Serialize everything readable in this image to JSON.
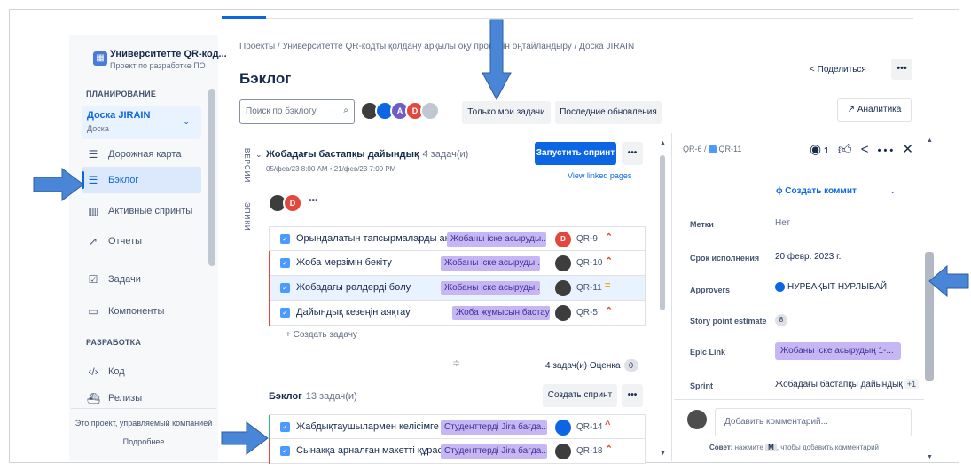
{
  "sidebar": {
    "project_name": "Университетте QR-код...",
    "project_type": "Проект по разработке ПО",
    "planning_header": "ПЛАНИРОВАНИЕ",
    "board_name": "Доска JIRAIN",
    "board_type": "Доска",
    "items": [
      {
        "label": "Дорожная карта",
        "icon": "roadmap-icon"
      },
      {
        "label": "Бэклог",
        "icon": "backlog-icon"
      },
      {
        "label": "Активные спринты",
        "icon": "sprint-board-icon"
      },
      {
        "label": "Отчеты",
        "icon": "reports-icon"
      },
      {
        "label": "Задачи",
        "icon": "issues-icon"
      },
      {
        "label": "Компоненты",
        "icon": "components-icon"
      }
    ],
    "dev_header": "РАЗРАБОТКА",
    "dev_items": [
      {
        "label": "Код",
        "icon": "code-icon"
      },
      {
        "label": "Релизы",
        "icon": "releases-icon"
      }
    ],
    "footer_text": "Это проект, управляемый компанией",
    "footer_link": "Подробнее"
  },
  "header": {
    "breadcrumb": "Проекты / Университетте QR-кодты қолдану арқылы оқу процесін оңтайландыру / Доска JIRAIN",
    "title": "Бэклог",
    "share_label": "Поделиться",
    "more_label": "•••",
    "analytics_label": "Аналитика"
  },
  "toolbar": {
    "search_placeholder": "Поиск по бэклогу",
    "avatars": [
      "",
      "",
      "A",
      "D",
      ""
    ],
    "only_my_issues": "Только мои задачи",
    "recent_updates": "Последние обновления"
  },
  "side_tabs": {
    "versions": "ВЕРСИИ",
    "epics": "ЭПИКИ"
  },
  "sprint": {
    "name": "Жобадағы бастапқы дайындық",
    "count": "4 задач(и)",
    "dates": "05/фев/23 8:00 AM • 21/фев/23 7:00 PM",
    "start_button": "Запустить спринт",
    "linked_pages": "View linked pages",
    "more": "•••",
    "create_issue": "+ Создать задачу",
    "estimate_text": "4 задач(и) Оценка",
    "estimate_value": "0",
    "issues": [
      {
        "summary": "Орындалатын тапсырмаларды анықта",
        "epic": "Жобаны іске асыруды...",
        "key": "QR-9",
        "priority": "highest",
        "assignee": "D"
      },
      {
        "summary": "Жоба мерзімін бекіту",
        "epic": "Жобаны іске асыруды...",
        "key": "QR-10",
        "priority": "highest",
        "assignee": ""
      },
      {
        "summary": "Жобадағы рөлдерді бөлу",
        "epic": "Жобаны іске асыруды...",
        "key": "QR-11",
        "priority": "medium",
        "assignee": ""
      },
      {
        "summary": "Дайындық кезеңін аяқтау",
        "epic": "Жоба жұмысын бастау",
        "key": "QR-5",
        "priority": "highest",
        "assignee": ""
      }
    ]
  },
  "backlog": {
    "title": "Бэклог",
    "count": "13 задач(и)",
    "create_sprint": "Создать спринт",
    "more": "•••",
    "issues": [
      {
        "summary": "Жабдықтаушылармен келісімге келу",
        "epic": "Студенттерді Jira бағда...",
        "key": "QR-14",
        "priority": "high"
      },
      {
        "summary": "Сынаққа арналған макетті құрастыру",
        "epic": "Студенттерді Jira бағда...",
        "key": "QR-18",
        "priority": "highest"
      }
    ]
  },
  "detail": {
    "breadcrumb_parent": "QR-6",
    "breadcrumb_child": "QR-11",
    "watch_count": "1",
    "create_commit": "Создать коммит",
    "fields": [
      {
        "label": "Метки",
        "value": "Нет"
      },
      {
        "label": "Срок исполнения",
        "value": "20 февр. 2023 г."
      },
      {
        "label": "Approvers",
        "value": "НУРБАҚЫТ НУРЛЫБАЙ"
      },
      {
        "label": "Story point estimate",
        "value": "8"
      },
      {
        "label": "Epic Link",
        "value": "Жобаны іске асырудың 1-..."
      },
      {
        "label": "Sprint",
        "value": "Жобадағы бастапқы дайындық",
        "extra": "+1"
      }
    ],
    "comment_placeholder": "Добавить комментарий...",
    "tip_label": "Совет:",
    "tip_pre": "нажмите",
    "tip_key": "M",
    "tip_post": ", чтобы добавить комментарий"
  },
  "colors": {
    "accent": "#0c66e4",
    "epic_bg": "#c6b6f4",
    "annotation_arrow": "#4a86d8",
    "priority_high": "#e2483d",
    "priority_medium": "#f5a623"
  }
}
